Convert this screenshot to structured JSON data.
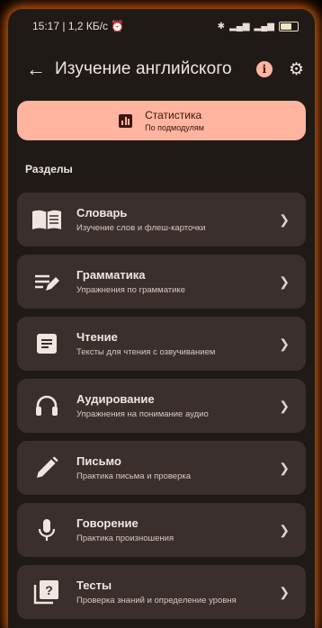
{
  "status_bar": {
    "time": "15:17",
    "speed": "1,2 КБ/с",
    "right_icons": [
      "bluetooth-icon",
      "signal-icon",
      "signal-icon",
      "battery-icon"
    ]
  },
  "appbar": {
    "back_icon": "back-arrow-icon",
    "title": "Изучение английского",
    "info_icon": "info-icon",
    "settings_icon": "gear-icon"
  },
  "stats_button": {
    "title": "Статистика",
    "subtitle": "По подмодулям",
    "icon": "bar-chart-icon",
    "bg_color": "#ffb4a0"
  },
  "section": {
    "title": "Разделы"
  },
  "modules": [
    {
      "title": "Словарь",
      "subtitle": "Изучение слов и флеш-карточки",
      "icon": "book-icon"
    },
    {
      "title": "Грамматика",
      "subtitle": "Упражнения по грамматике",
      "icon": "edit-notes-icon"
    },
    {
      "title": "Чтение",
      "subtitle": "Тексты для чтения с озвучиванием",
      "icon": "article-icon"
    },
    {
      "title": "Аудирование",
      "subtitle": "Упражнения на понимание аудио",
      "icon": "headphones-icon"
    },
    {
      "title": "Письмо",
      "subtitle": "Практика письма и проверка",
      "icon": "pencil-icon"
    },
    {
      "title": "Говорение",
      "subtitle": "Практика произношения",
      "icon": "microphone-icon"
    },
    {
      "title": "Тесты",
      "subtitle": "Проверка знаний и определение уровня",
      "icon": "quiz-icon"
    }
  ]
}
